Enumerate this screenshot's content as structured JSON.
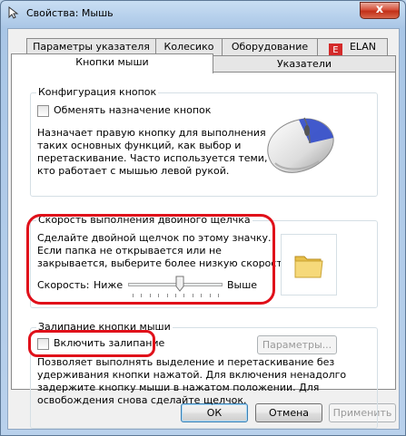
{
  "window": {
    "title": "Свойства: Мышь",
    "close_label": "x"
  },
  "tabs": {
    "back_row": [
      "Параметры указателя",
      "Колесико",
      "Оборудование",
      "ELAN"
    ],
    "front_row": [
      "Кнопки мыши",
      "Указатели"
    ],
    "active": "Кнопки мыши"
  },
  "button_config": {
    "legend": "Конфигурация кнопок",
    "swap_label": "Обменять назначение кнопок",
    "swap_checked": false,
    "description": [
      "Назначает правую кнопку для выполнения",
      "таких основных функций, как выбор и",
      "перетаскивание. Часто используется теми,",
      "кто работает с мышью левой рукой."
    ]
  },
  "double_click": {
    "legend": "Скорость выполнения двойного щелчка",
    "description": [
      "Сделайте двойной щелчок по этому значку.",
      "Если папка не открывается или не",
      "закрывается, выберите более низкую скорость."
    ],
    "speed_label": "Скорость:",
    "slow_label": "Ниже",
    "fast_label": "Выше",
    "speed_fraction": 0.55
  },
  "click_lock": {
    "legend": "Залипание кнопки мыши",
    "enable_label": "Включить залипание",
    "enabled": false,
    "settings_button": "Параметры...",
    "description": [
      "Позволяет выполнять выделение и перетаскивание без",
      "удерживания кнопки нажатой. Для включения ненадолго",
      "задержите кнопку мыши в нажатом положении. Для",
      "освобождения снова сделайте щелчок."
    ]
  },
  "footer": {
    "ok": "ОК",
    "cancel": "Отмена",
    "apply": "Применить"
  },
  "colors": {
    "highlight": "#e0101a",
    "mouse_accent": "#2f49c9"
  }
}
